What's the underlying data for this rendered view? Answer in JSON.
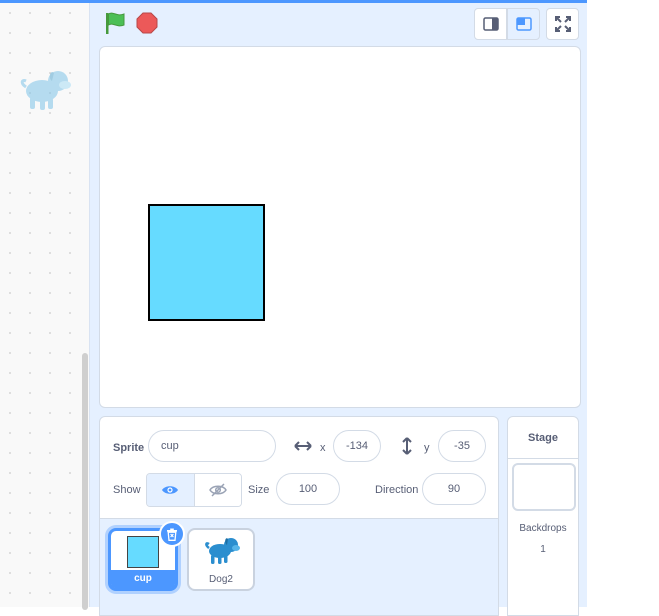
{
  "stage_header": {
    "green_flag_icon": "green-flag-icon",
    "stop_icon": "stop-icon"
  },
  "sprite_info": {
    "sprite_label": "Sprite",
    "sprite_name": "cup",
    "x_label": "x",
    "x_value": "-134",
    "y_label": "y",
    "y_value": "-35",
    "show_label": "Show",
    "size_label": "Size",
    "size_value": "100",
    "direction_label": "Direction",
    "direction_value": "90"
  },
  "sprites": [
    {
      "name": "cup",
      "selected": true
    },
    {
      "name": "Dog2",
      "selected": false
    }
  ],
  "stage_selector": {
    "title": "Stage",
    "backdrops_label": "Backdrops",
    "backdrops_count": "1"
  },
  "colors": {
    "accent": "#4c97ff",
    "panel_bg": "#e5f0ff",
    "cup_fill": "#66dbff",
    "flag": "#4cbf56",
    "stop": "#ec5959"
  }
}
